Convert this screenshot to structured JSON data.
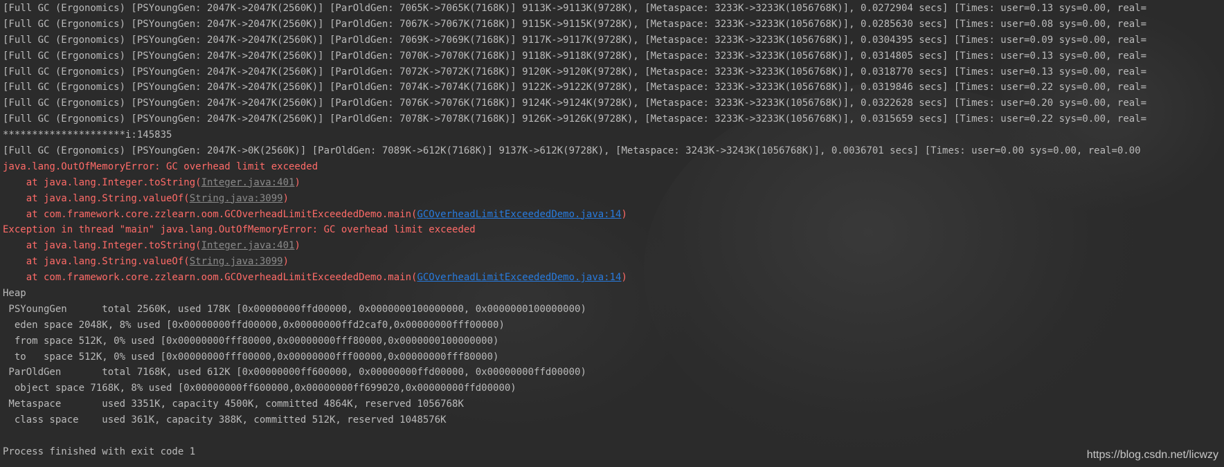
{
  "gc_lines": [
    "[Full GC (Ergonomics) [PSYoungGen: 2047K->2047K(2560K)] [ParOldGen: 7065K->7065K(7168K)] 9113K->9113K(9728K), [Metaspace: 3233K->3233K(1056768K)], 0.0272904 secs] [Times: user=0.13 sys=0.00, real=",
    "[Full GC (Ergonomics) [PSYoungGen: 2047K->2047K(2560K)] [ParOldGen: 7067K->7067K(7168K)] 9115K->9115K(9728K), [Metaspace: 3233K->3233K(1056768K)], 0.0285630 secs] [Times: user=0.08 sys=0.00, real=",
    "[Full GC (Ergonomics) [PSYoungGen: 2047K->2047K(2560K)] [ParOldGen: 7069K->7069K(7168K)] 9117K->9117K(9728K), [Metaspace: 3233K->3233K(1056768K)], 0.0304395 secs] [Times: user=0.09 sys=0.00, real=",
    "[Full GC (Ergonomics) [PSYoungGen: 2047K->2047K(2560K)] [ParOldGen: 7070K->7070K(7168K)] 9118K->9118K(9728K), [Metaspace: 3233K->3233K(1056768K)], 0.0314805 secs] [Times: user=0.13 sys=0.00, real=",
    "[Full GC (Ergonomics) [PSYoungGen: 2047K->2047K(2560K)] [ParOldGen: 7072K->7072K(7168K)] 9120K->9120K(9728K), [Metaspace: 3233K->3233K(1056768K)], 0.0318770 secs] [Times: user=0.13 sys=0.00, real=",
    "[Full GC (Ergonomics) [PSYoungGen: 2047K->2047K(2560K)] [ParOldGen: 7074K->7074K(7168K)] 9122K->9122K(9728K), [Metaspace: 3233K->3233K(1056768K)], 0.0319846 secs] [Times: user=0.22 sys=0.00, real=",
    "[Full GC (Ergonomics) [PSYoungGen: 2047K->2047K(2560K)] [ParOldGen: 7076K->7076K(7168K)] 9124K->9124K(9728K), [Metaspace: 3233K->3233K(1056768K)], 0.0322628 secs] [Times: user=0.20 sys=0.00, real=",
    "[Full GC (Ergonomics) [PSYoungGen: 2047K->2047K(2560K)] [ParOldGen: 7078K->7078K(7168K)] 9126K->9126K(9728K), [Metaspace: 3233K->3233K(1056768K)], 0.0315659 secs] [Times: user=0.22 sys=0.00, real="
  ],
  "counter_line": "*********************i:145835",
  "final_gc_line": "[Full GC (Ergonomics) [PSYoungGen: 2047K->0K(2560K)] [ParOldGen: 7089K->612K(7168K)] 9137K->612K(9728K), [Metaspace: 3243K->3243K(1056768K)], 0.0036701 secs] [Times: user=0.00 sys=0.00, real=0.00",
  "error1": {
    "message": "java.lang.OutOfMemoryError: GC overhead limit exceeded",
    "frames": [
      {
        "prefix": "    at java.lang.Integer.toString(",
        "link": "Integer.java:401",
        "suffix": ")"
      },
      {
        "prefix": "    at java.lang.String.valueOf(",
        "link": "String.java:3099",
        "suffix": ")"
      },
      {
        "prefix": "    at com.framework.core.zzlearn.oom.GCOverheadLimitExceededDemo.main(",
        "link": "GCOverheadLimitExceededDemo.java:14",
        "suffix": ")"
      }
    ]
  },
  "error2": {
    "message": "Exception in thread \"main\" java.lang.OutOfMemoryError: GC overhead limit exceeded",
    "frames": [
      {
        "prefix": "    at java.lang.Integer.toString(",
        "link": "Integer.java:401",
        "suffix": ")"
      },
      {
        "prefix": "    at java.lang.String.valueOf(",
        "link": "String.java:3099",
        "suffix": ")"
      },
      {
        "prefix": "    at com.framework.core.zzlearn.oom.GCOverheadLimitExceededDemo.main(",
        "link": "GCOverheadLimitExceededDemo.java:14",
        "suffix": ")"
      }
    ]
  },
  "heap_lines": [
    "Heap",
    " PSYoungGen      total 2560K, used 178K [0x00000000ffd00000, 0x0000000100000000, 0x0000000100000000)",
    "  eden space 2048K, 8% used [0x00000000ffd00000,0x00000000ffd2caf0,0x00000000fff00000)",
    "  from space 512K, 0% used [0x00000000fff80000,0x00000000fff80000,0x0000000100000000)",
    "  to   space 512K, 0% used [0x00000000fff00000,0x00000000fff00000,0x00000000fff80000)",
    " ParOldGen       total 7168K, used 612K [0x00000000ff600000, 0x00000000ffd00000, 0x00000000ffd00000)",
    "  object space 7168K, 8% used [0x00000000ff600000,0x00000000ff699020,0x00000000ffd00000)",
    " Metaspace       used 3351K, capacity 4500K, committed 4864K, reserved 1056768K",
    "  class space    used 361K, capacity 388K, committed 512K, reserved 1048576K"
  ],
  "exit_line": "Process finished with exit code 1",
  "watermark": "https://blog.csdn.net/licwzy",
  "colors": {
    "background": "#2b2b2b",
    "text": "#bbbbbb",
    "error": "#ff6b68",
    "local_link": "#287bde",
    "library_link": "#8a8a8a"
  }
}
